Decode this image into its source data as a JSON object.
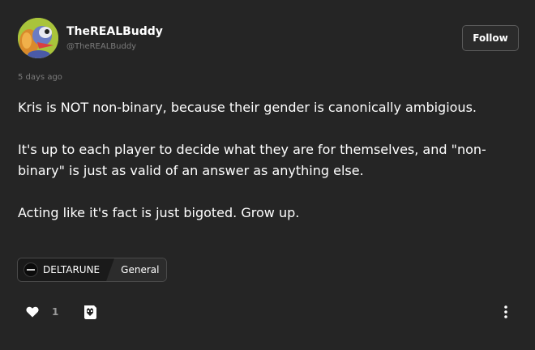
{
  "post": {
    "author": {
      "display_name": "TheREALBuddy",
      "handle": "@TheREALBuddy",
      "avatar_icon": "avatar-character-icon"
    },
    "follow_label": "Follow",
    "timestamp": "5 days ago",
    "paragraphs": [
      "Kris is NOT non-binary, because their gender is canonically ambigious.",
      "It's up to each player to decide what they are for themselves, and \"non-binary\" is just as valid of an answer as anything else.",
      "Acting like it's fact is just bigoted. Grow up."
    ],
    "tag": {
      "community": "DELTARUNE",
      "flair": "General"
    },
    "actions": {
      "like_count": "1",
      "like_icon": "heart-icon",
      "reaction_icon": "reaction-sticker-icon",
      "more_icon": "more-vertical-icon"
    }
  },
  "colors": {
    "background": "#252525",
    "text": "#ffffff",
    "muted": "#7b7b7b"
  }
}
